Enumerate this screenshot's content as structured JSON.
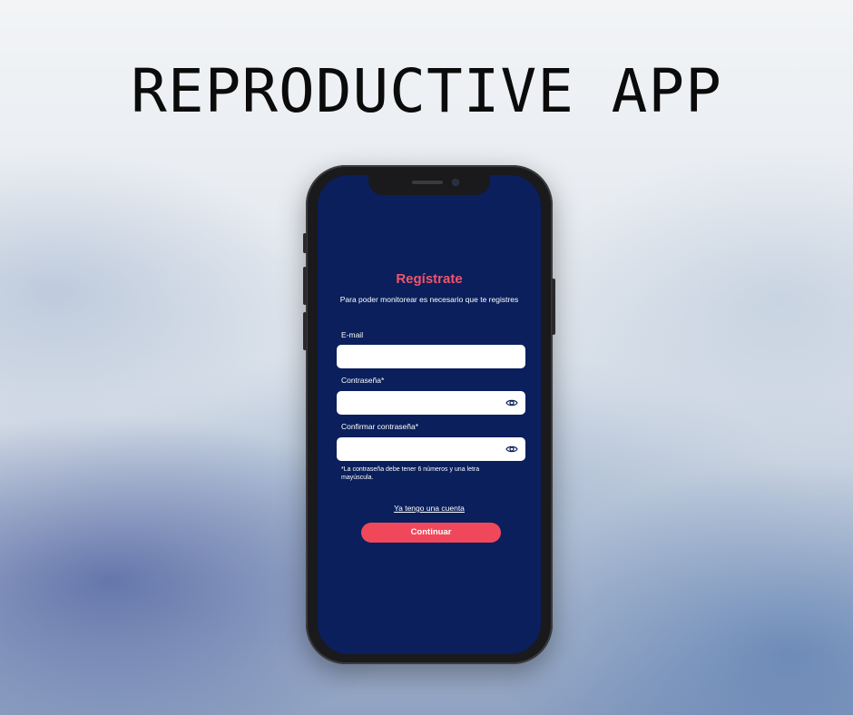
{
  "page": {
    "heading": "REPRODUCTIVE APP"
  },
  "screen": {
    "title": "Regístrate",
    "subtitle": "Para poder monitorear es necesario que te registres",
    "fields": [
      {
        "label": "E-mail",
        "value": "",
        "placeholder": ""
      },
      {
        "label": "Contraseña*",
        "value": "",
        "placeholder": "",
        "icon": "eye-icon"
      },
      {
        "label": "Confirmar contraseña*",
        "value": "",
        "placeholder": "",
        "icon": "eye-icon"
      }
    ],
    "hint": "*La contraseña debe tener 6 números y una letra mayúscula.",
    "login_link": "Ya tengo una cuenta",
    "continue_label": "Continuar"
  },
  "colors": {
    "screen_bg": "#0a1f5c",
    "accent": "#f0485a",
    "title": "#f0556a"
  }
}
